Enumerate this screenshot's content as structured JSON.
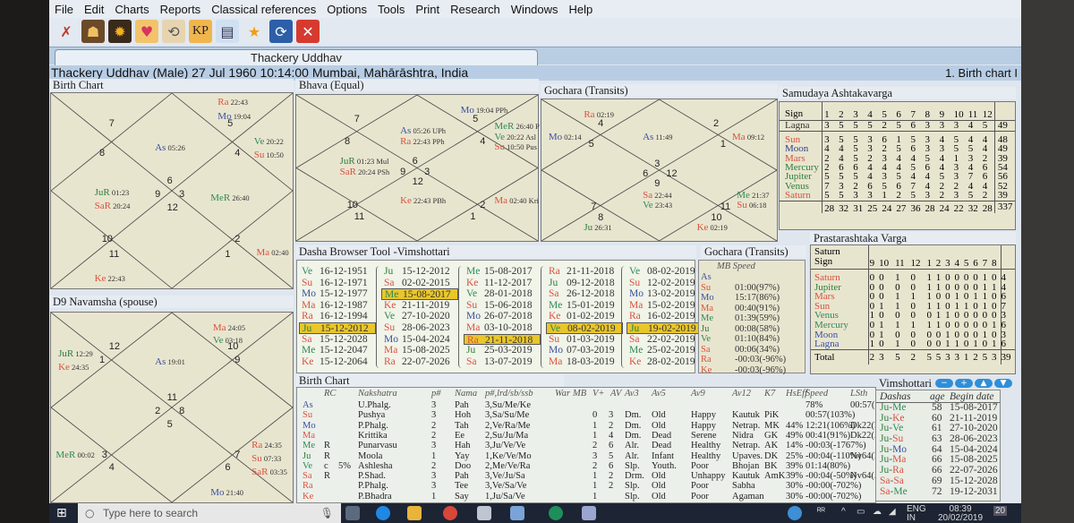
{
  "menu": [
    "File",
    "Edit",
    "Charts",
    "Reports",
    "Classical references",
    "Options",
    "Tools",
    "Print",
    "Research",
    "Windows",
    "Help"
  ],
  "toolbar_icons": [
    "tools-icon",
    "silhouette-icon",
    "sun-icon",
    "hearts-icon",
    "chart-rotate-icon",
    "kp-icon",
    "chart-notes-icon",
    "star-icon",
    "sync-icon",
    "close-icon"
  ],
  "toolbar_kp_label": "KP",
  "tab_title": "Thackery Uddhav",
  "info": {
    "person": "Thackery Uddhav (Male) 27 Jul 1960 10:14:00  Mumbai, Mahārāshtra, India",
    "right_label": "1. Birth chart I"
  },
  "birth_chart": {
    "title": "Birth Chart",
    "houses": [
      "7",
      "8",
      "5",
      "4",
      "6",
      "9",
      "3",
      "12",
      "10",
      "11",
      "2",
      "1"
    ],
    "planets": [
      {
        "name": "Ra",
        "deg": "22:43",
        "color": "red"
      },
      {
        "name": "Mo",
        "deg": "19:04",
        "color": "blue"
      },
      {
        "name": "As",
        "deg": "05:26",
        "color": "blue"
      },
      {
        "name": "Ve",
        "deg": "20:22",
        "color": "green"
      },
      {
        "name": "Su",
        "deg": "10:50",
        "color": "red"
      },
      {
        "name": "JuR",
        "deg": "01:23",
        "color": "green"
      },
      {
        "name": "SaR",
        "deg": "20:24",
        "color": "red"
      },
      {
        "name": "MeR",
        "deg": "26:40",
        "color": "green"
      },
      {
        "name": "Ma",
        "deg": "02:40",
        "color": "red"
      },
      {
        "name": "Ke",
        "deg": "22:43",
        "color": "red"
      }
    ]
  },
  "bhava_chart": {
    "title": "Bhava (Equal)",
    "houses": [
      "7",
      "8",
      "5",
      "4",
      "6",
      "9",
      "3",
      "12",
      "10",
      "11",
      "2",
      "1"
    ],
    "planets": [
      {
        "name": "Mo",
        "deg": "19:04 PPh"
      },
      {
        "name": "MeR",
        "deg": "26:40 P"
      },
      {
        "name": "Ve",
        "deg": "20:22 Asl"
      },
      {
        "name": "Su",
        "deg": "10:50 Pus"
      },
      {
        "name": "As",
        "deg": "05:26 UPh"
      },
      {
        "name": "Ra",
        "deg": "22:43 PPh"
      },
      {
        "name": "JuR",
        "deg": "01:23 Mul"
      },
      {
        "name": "SaR",
        "deg": "20:24 PSh"
      },
      {
        "name": "Ke",
        "deg": "22:43 PBh"
      },
      {
        "name": "Ma",
        "deg": "02:40 Kri"
      }
    ]
  },
  "gochara_chart": {
    "title": "Gochara (Transits)",
    "houses": [
      "4",
      "5",
      "2",
      "1",
      "3",
      "6",
      "12",
      "9",
      "7",
      "8",
      "11",
      "10"
    ],
    "planets": [
      {
        "name": "Ra",
        "deg": "02:19"
      },
      {
        "name": "Mo",
        "deg": "02:14"
      },
      {
        "name": "As",
        "deg": "11:49"
      },
      {
        "name": "Ma",
        "deg": "09:12"
      },
      {
        "name": "Sa",
        "deg": "22:44"
      },
      {
        "name": "Ve",
        "deg": "23:43"
      },
      {
        "name": "Me",
        "deg": "21:37"
      },
      {
        "name": "Su",
        "deg": "06:18"
      },
      {
        "name": "Ju",
        "deg": "26:31"
      },
      {
        "name": "Ke",
        "deg": "02:19"
      }
    ]
  },
  "navamsha_chart": {
    "title": "D9 Navamsha  (spouse)",
    "houses": [
      "12",
      "1",
      "10",
      "9",
      "11",
      "2",
      "8",
      "5",
      "3",
      "4",
      "7",
      "6"
    ],
    "planets": [
      {
        "name": "Ma",
        "deg": "24:05"
      },
      {
        "name": "Ve",
        "deg": "03:18"
      },
      {
        "name": "JuR",
        "deg": "12:29"
      },
      {
        "name": "Ke",
        "deg": "24:35"
      },
      {
        "name": "As",
        "deg": "19:01"
      },
      {
        "name": "MeR",
        "deg": "00:02"
      },
      {
        "name": "Ra",
        "deg": "24:35"
      },
      {
        "name": "Su",
        "deg": "07:33"
      },
      {
        "name": "SaR",
        "deg": "03:35"
      },
      {
        "name": "Mo",
        "deg": "21:40"
      }
    ]
  },
  "samudaya": {
    "title": "Samudaya Ashtakavarga",
    "sign_label": "Sign",
    "signs": [
      "1",
      "2",
      "3",
      "4",
      "5",
      "6",
      "7",
      "8",
      "9",
      "10",
      "11",
      "12"
    ],
    "lagna": {
      "name": "Lagna",
      "values": [
        "3",
        "5",
        "5",
        "5",
        "2",
        "5",
        "6",
        "3",
        "3",
        "3",
        "4",
        "5"
      ],
      "total": "49"
    },
    "rows": [
      {
        "name": "Sun",
        "values": [
          "3",
          "5",
          "5",
          "3",
          "6",
          "1",
          "5",
          "3",
          "4",
          "5",
          "4",
          "4"
        ],
        "total": "48"
      },
      {
        "name": "Moon",
        "values": [
          "4",
          "4",
          "5",
          "3",
          "2",
          "5",
          "6",
          "3",
          "3",
          "5",
          "5",
          "4"
        ],
        "total": "49"
      },
      {
        "name": "Mars",
        "values": [
          "2",
          "4",
          "5",
          "2",
          "3",
          "4",
          "4",
          "5",
          "4",
          "1",
          "3",
          "2"
        ],
        "total": "39"
      },
      {
        "name": "Mercury",
        "values": [
          "2",
          "6",
          "6",
          "4",
          "4",
          "4",
          "5",
          "6",
          "4",
          "3",
          "4",
          "6"
        ],
        "total": "54"
      },
      {
        "name": "Jupiter",
        "values": [
          "5",
          "5",
          "5",
          "4",
          "3",
          "5",
          "4",
          "4",
          "5",
          "3",
          "7",
          "6"
        ],
        "total": "56"
      },
      {
        "name": "Venus",
        "values": [
          "7",
          "3",
          "2",
          "6",
          "5",
          "6",
          "7",
          "4",
          "2",
          "2",
          "4",
          "4"
        ],
        "total": "52"
      },
      {
        "name": "Saturn",
        "values": [
          "5",
          "5",
          "3",
          "3",
          "1",
          "2",
          "5",
          "3",
          "2",
          "3",
          "5",
          "2"
        ],
        "total": "39"
      }
    ],
    "totals": [
      "28",
      "32",
      "31",
      "25",
      "24",
      "27",
      "36",
      "28",
      "24",
      "22",
      "32",
      "28"
    ],
    "grand_total": "337"
  },
  "prastarashtaka": {
    "title": "Prastarashtaka Varga",
    "planet_label": "Saturn",
    "sign_label": "Sign",
    "signs": [
      "9",
      "10",
      "11",
      "12",
      "1",
      "2",
      "3",
      "4",
      "5",
      "6",
      "7",
      "8"
    ],
    "rows": [
      {
        "name": "Saturn",
        "values": [
          "0",
          "0",
          "1",
          "0",
          "1",
          "1",
          "0",
          "0",
          "0",
          "0",
          "1",
          "0"
        ],
        "total": "4"
      },
      {
        "name": "Jupiter",
        "values": [
          "0",
          "0",
          "0",
          "0",
          "1",
          "1",
          "0",
          "0",
          "0",
          "0",
          "1",
          "1"
        ],
        "total": "4"
      },
      {
        "name": "Mars",
        "values": [
          "0",
          "0",
          "1",
          "1",
          "1",
          "0",
          "0",
          "1",
          "0",
          "1",
          "1",
          "0"
        ],
        "total": "6"
      },
      {
        "name": "Sun",
        "values": [
          "0",
          "1",
          "1",
          "0",
          "1",
          "1",
          "0",
          "1",
          "1",
          "0",
          "1",
          "0"
        ],
        "total": "7"
      },
      {
        "name": "Venus",
        "values": [
          "1",
          "0",
          "0",
          "0",
          "0",
          "1",
          "1",
          "0",
          "0",
          "0",
          "0",
          "0"
        ],
        "total": "3"
      },
      {
        "name": "Mercury",
        "values": [
          "0",
          "1",
          "1",
          "1",
          "1",
          "1",
          "0",
          "0",
          "0",
          "0",
          "0",
          "1"
        ],
        "total": "6"
      },
      {
        "name": "Moon",
        "values": [
          "0",
          "1",
          "0",
          "0",
          "0",
          "0",
          "1",
          "0",
          "0",
          "0",
          "1",
          "0"
        ],
        "total": "3"
      },
      {
        "name": "Lagna",
        "values": [
          "1",
          "0",
          "1",
          "0",
          "0",
          "0",
          "1",
          "1",
          "0",
          "1",
          "0",
          "1"
        ],
        "total": "6"
      }
    ],
    "total_label": "Total",
    "totals": [
      "2",
      "3",
      "5",
      "2",
      "5",
      "5",
      "3",
      "3",
      "1",
      "2",
      "5",
      "3"
    ],
    "grand_total": "39"
  },
  "dasha_browser": {
    "title": "Dasha Browser Tool -Vimshottari",
    "columns": [
      [
        [
          "Ve",
          "16-12-1951"
        ],
        [
          "Su",
          "16-12-1971"
        ],
        [
          "Mo",
          "15-12-1977"
        ],
        [
          "Ma",
          "16-12-1987"
        ],
        [
          "Ra",
          "16-12-1994"
        ],
        [
          "Ju",
          "15-12-2012"
        ],
        [
          "Sa",
          "15-12-2028"
        ],
        [
          "Me",
          "15-12-2047"
        ],
        [
          "Ke",
          "15-12-2064"
        ]
      ],
      [
        [
          "Ju",
          "15-12-2012"
        ],
        [
          "Sa",
          "02-02-2015"
        ],
        [
          "Me",
          "15-08-2017"
        ],
        [
          "Ke",
          "21-11-2019"
        ],
        [
          "Ve",
          "27-10-2020"
        ],
        [
          "Su",
          "28-06-2023"
        ],
        [
          "Mo",
          "15-04-2024"
        ],
        [
          "Ma",
          "15-08-2025"
        ],
        [
          "Ra",
          "22-07-2026"
        ]
      ],
      [
        [
          "Me",
          "15-08-2017"
        ],
        [
          "Ke",
          "11-12-2017"
        ],
        [
          "Ve",
          "28-01-2018"
        ],
        [
          "Su",
          "15-06-2018"
        ],
        [
          "Mo",
          "26-07-2018"
        ],
        [
          "Ma",
          "03-10-2018"
        ],
        [
          "Ra",
          "21-11-2018"
        ],
        [
          "Ju",
          "25-03-2019"
        ],
        [
          "Sa",
          "13-07-2019"
        ]
      ],
      [
        [
          "Ra",
          "21-11-2018"
        ],
        [
          "Ju",
          "09-12-2018"
        ],
        [
          "Sa",
          "26-12-2018"
        ],
        [
          "Me",
          "15-01-2019"
        ],
        [
          "Ke",
          "01-02-2019"
        ],
        [
          "Ve",
          "08-02-2019"
        ],
        [
          "Su",
          "01-03-2019"
        ],
        [
          "Mo",
          "07-03-2019"
        ],
        [
          "Ma",
          "18-03-2019"
        ]
      ],
      [
        [
          "Ve",
          "08-02-2019"
        ],
        [
          "Su",
          "12-02-2019"
        ],
        [
          "Mo",
          "13-02-2019"
        ],
        [
          "Ma",
          "15-02-2019"
        ],
        [
          "Ra",
          "16-02-2019"
        ],
        [
          "Ju",
          "19-02-2019"
        ],
        [
          "Sa",
          "22-02-2019"
        ],
        [
          "Me",
          "25-02-2019"
        ],
        [
          "Ke",
          "28-02-2019"
        ]
      ]
    ],
    "selected": [
      5,
      2,
      6,
      5,
      5
    ]
  },
  "gochara_speed": {
    "title": "Gochara (Transits)",
    "header": "MB Speed",
    "rows": [
      [
        "As",
        ""
      ],
      [
        "Su",
        "01:00(97%)"
      ],
      [
        "Mo",
        "15:17(86%)"
      ],
      [
        "Ma",
        "00:40(91%)"
      ],
      [
        "Me",
        "01:39(59%)"
      ],
      [
        "Ju",
        "00:08(58%)"
      ],
      [
        "Ve",
        "01:10(84%)"
      ],
      [
        "Sa",
        "00:06(34%)"
      ],
      [
        "Ra",
        "-00:03(-96%)"
      ],
      [
        "Ke",
        "-00:03(-96%)"
      ]
    ]
  },
  "birth_table": {
    "title": "Birth Chart",
    "headers": [
      "RC",
      "Nakshatra",
      "p#",
      "Nama",
      "p#,lrd/sb/ssb",
      "War",
      "MB",
      "V+",
      "AV",
      "Av3",
      "Av5",
      "Av9",
      "Av12",
      "K7",
      "HsEff",
      "Speed",
      "LSth"
    ],
    "rows": [
      [
        "As",
        "",
        "",
        "U.Phalg.",
        "3",
        "Pah",
        "3,Su/Me/Ke",
        "",
        "",
        "",
        "",
        "",
        "",
        "",
        "",
        "78%",
        "00:57(103%)",
        ""
      ],
      [
        "Su",
        "",
        "",
        "Pushya",
        "3",
        "Hoh",
        "3,Sa/Su/Me",
        "0",
        "3",
        "Dm.",
        "Old",
        "Happy",
        "Kautuk",
        "PiK",
        "",
        "00:57(103%)",
        ""
      ],
      [
        "Mo",
        "",
        "",
        "P.Phalg.",
        "2",
        "Tah",
        "2,Ve/Ra/Me",
        "1",
        "2",
        "Dm.",
        "Old",
        "Happy",
        "Netrap.",
        "MK",
        "44%",
        "12:21(106%)",
        "Dk22(Mo)"
      ],
      [
        "Ma",
        "",
        "",
        "Krittika",
        "2",
        "Ee",
        "2,Su/Ju/Ma",
        "1",
        "4",
        "Dm.",
        "Dead",
        "Serene",
        "Nidra",
        "GK",
        "49%",
        "00:41(91%)",
        "Dk22(As)"
      ],
      [
        "Me",
        "R",
        "",
        "Punarvasu",
        "3",
        "Hah",
        "3,Ju/Ve/Ve",
        "2",
        "6",
        "Alr.",
        "Dead",
        "Healthy",
        "Netrap.",
        "AK",
        "14%",
        "-00:03(-1767%)",
        ""
      ],
      [
        "Ju",
        "R",
        "",
        "Moola",
        "1",
        "Yay",
        "1,Ke/Ve/Mo",
        "3",
        "5",
        "Alr.",
        "Infant",
        "Healthy",
        "Upaves.",
        "DK",
        "25%",
        "-00:04(-110%)",
        "Nv64(Mo)"
      ],
      [
        "Ve",
        "c",
        "5%",
        "Ashlesha",
        "2",
        "Doo",
        "2,Me/Ve/Ra",
        "2",
        "6",
        "Slp.",
        "Youth.",
        "Poor",
        "Bhojan",
        "BK",
        "39%",
        "01:14(80%)",
        ""
      ],
      [
        "Sa",
        "R",
        "",
        "P.Shad.",
        "3",
        "Pah",
        "3,Ve/Ju/Sa",
        "1",
        "2",
        "Drm.",
        "Old",
        "Unhappy",
        "Kautuk",
        "AmK",
        "39%",
        "-00:04(-50%)",
        "Nv64(As)"
      ],
      [
        "Ra",
        "",
        "",
        "P.Phalg.",
        "3",
        "Tee",
        "3,Ve/Sa/Ve",
        "1",
        "2",
        "Slp.",
        "Old",
        "Poor",
        "Sabha",
        "",
        "30%",
        "-00:00(-702%)",
        ""
      ],
      [
        "Ke",
        "",
        "",
        "P.Bhadra",
        "1",
        "Say",
        "1,Ju/Sa/Ve",
        "1",
        "",
        "Slp.",
        "Old",
        "Poor",
        "Agaman",
        "",
        "30%",
        "-00:00(-702%)",
        ""
      ]
    ]
  },
  "vimshottari": {
    "title": "Vimshottari",
    "buttons": [
      "−",
      "+",
      "▲",
      "▼"
    ],
    "headers": [
      "Dashas",
      "age",
      "Begin date"
    ],
    "rows": [
      [
        "Ju-Me",
        "58",
        "15-08-2017"
      ],
      [
        "Ju-Ke",
        "60",
        "21-11-2019"
      ],
      [
        "Ju-Ve",
        "61",
        "27-10-2020"
      ],
      [
        "Ju-Su",
        "63",
        "28-06-2023"
      ],
      [
        "Ju-Mo",
        "64",
        "15-04-2024"
      ],
      [
        "Ju-Ma",
        "66",
        "15-08-2025"
      ],
      [
        "Ju-Ra",
        "66",
        "22-07-2026"
      ],
      [
        "Sa-Sa",
        "69",
        "15-12-2028"
      ],
      [
        "Sa-Me",
        "72",
        "19-12-2031"
      ]
    ]
  },
  "taskbar": {
    "search_placeholder": "Type here to search",
    "lang_top": "ENG",
    "lang_bottom": "IN",
    "time": "08:39",
    "date": "20/02/2019",
    "notifications": "20"
  },
  "colors": {
    "Su": "#d9523f",
    "Mo": "#3a4fa0",
    "Ma": "#d9523f",
    "Me": "#2f8a55",
    "Ju": "#2f7d3a",
    "Ve": "#2f8a55",
    "Sa": "#d9523f",
    "Ra": "#d9523f",
    "Ke": "#d9523f",
    "As": "#3a4fa0"
  }
}
